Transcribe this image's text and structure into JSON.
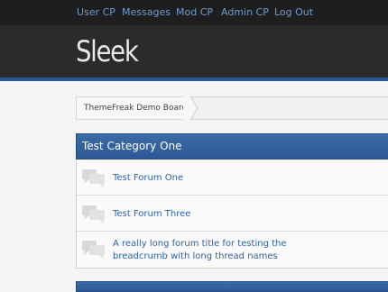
{
  "topnav": {
    "links": [
      {
        "label": "User CP"
      },
      {
        "label": "Messages"
      },
      {
        "label": "Mod CP"
      },
      {
        "label": "Admin CP"
      },
      {
        "label": "Log Out"
      }
    ]
  },
  "header": {
    "logo_text": "Sleek"
  },
  "breadcrumb": {
    "items": [
      {
        "label": "ThemeFreak Demo Board"
      }
    ]
  },
  "category": {
    "title": "Test Category One",
    "forums": [
      {
        "title": "Test Forum One",
        "icon": "speech-bubbles-icon"
      },
      {
        "title": "Test Forum Three",
        "icon": "speech-bubbles-icon"
      },
      {
        "title": "A really long forum title for testing the breadcrumb with long thread names",
        "icon": "speech-bubbles-icon"
      }
    ]
  },
  "colors": {
    "accent": "#2d5994",
    "link": "#2f63a8",
    "topnav_link": "#6e9bd1",
    "header_bg": "#2b2b2b",
    "topnav_bg": "#1e1e1e"
  }
}
